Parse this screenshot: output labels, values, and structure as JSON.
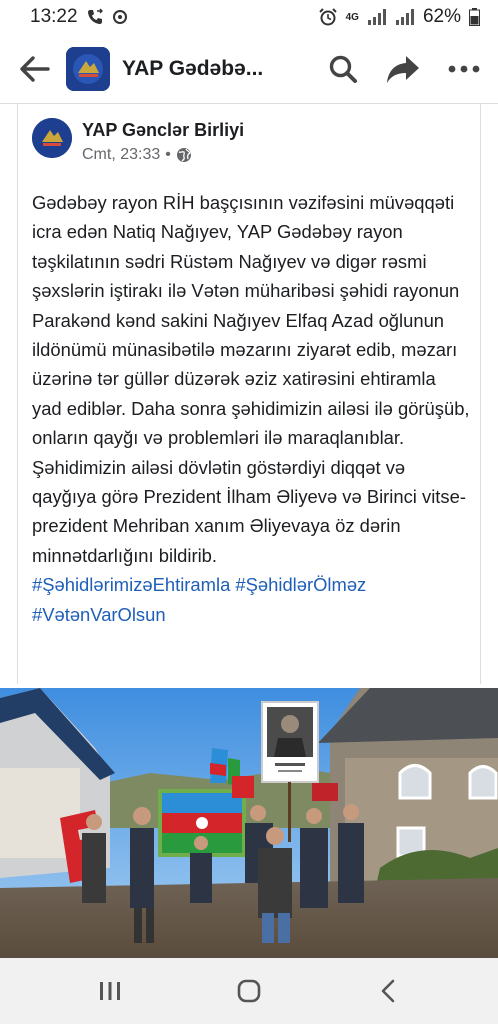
{
  "status_bar": {
    "time": "13:22",
    "network": "4G",
    "battery": "62%"
  },
  "header": {
    "title": "YAP Gədəbə...",
    "icons": [
      "back-arrow-icon",
      "search-icon",
      "share-icon",
      "more-icon"
    ]
  },
  "post": {
    "author": "YAP Gənclər Birliyi",
    "timestamp": "Cmt, 23:33",
    "separator": "•",
    "privacy_icon": "globe-icon",
    "body": "Gədəbəy rayon RİH başçısının vəzifəsini müvəqqəti icra edən Natiq Nağıyev, YAP Gədəbəy rayon təşkilatının sədri Rüstəm Nağıyev və digər rəsmi şəxslərin iştirakı ilə Vətən müharibəsi şəhidi rayonun Parakənd kənd sakini Nağıyev Elfaq Azad oğlunun ildönümü münasibətilə məzarını ziyarət edib, məzarı üzərinə tər güllər düzərək əziz xatirəsini ehtiramla yad ediblər. Daha sonra şəhidimizin ailəsi ilə görüşüb, onların qayğı və problemləri ilə maraqlanıblar. Şəhidimizin ailəsi dövlətin göstərdiyi diqqət və qayğıya görə Prezident İlham Əliyevə və Birinci vitse-prezident Mehriban xanım Əliyevaya öz dərin minnətdarlığını bildirib.",
    "hashtags": [
      "#ŞəhidlərimizəEhtiramla",
      "#ŞəhidlərÖlməz",
      "#VətənVarOlsun"
    ]
  },
  "nav_bar": {
    "icons": [
      "recent-apps-icon",
      "home-icon",
      "back-icon"
    ]
  },
  "colors": {
    "hashtag": "#1f5fb8",
    "brand": "#1e3f8f",
    "meta": "#65676b"
  }
}
